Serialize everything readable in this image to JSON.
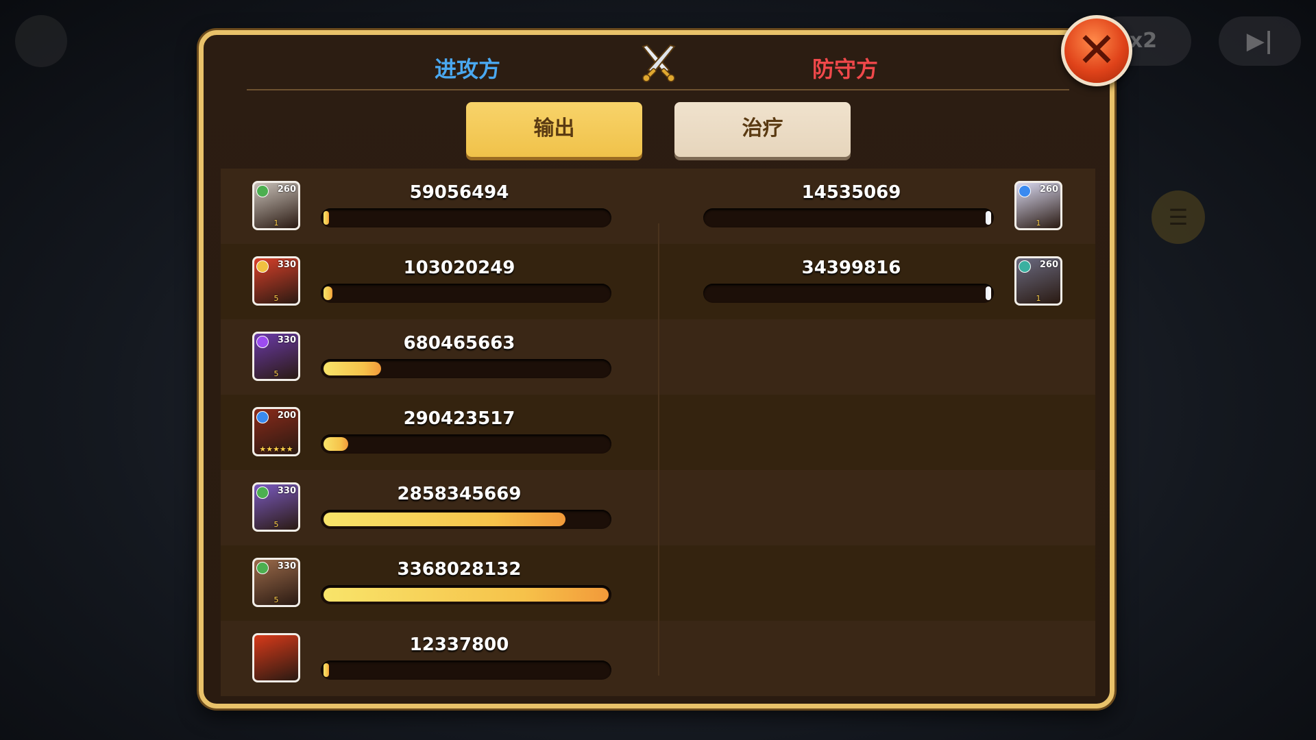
{
  "background": {
    "speed_label": "x2",
    "skip_label": "▶|",
    "list_icon": "☰"
  },
  "dialog": {
    "attacker_title": "进攻方",
    "defender_title": "防守方",
    "close_label": "✕",
    "tabs": [
      {
        "label": "输出",
        "selected": true
      },
      {
        "label": "治疗",
        "selected": false
      }
    ]
  },
  "attackers": [
    {
      "value": "59056494",
      "level": "260",
      "stars": "1",
      "faction_color": "#4caf50",
      "portrait_color": "#c8c0b8",
      "fraction": 0.018
    },
    {
      "value": "103020249",
      "level": "330",
      "stars": "5",
      "faction_color": "#f0c040",
      "portrait_color": "#d8402a",
      "fraction": 0.031
    },
    {
      "value": "680465663",
      "level": "330",
      "stars": "5",
      "faction_color": "#9c4cf0",
      "portrait_color": "#6a3aa8",
      "fraction": 0.202
    },
    {
      "value": "290423517",
      "level": "200",
      "stars": "★★★★★",
      "faction_color": "#3a8af0",
      "portrait_color": "#8a2a1a",
      "fraction": 0.086
    },
    {
      "value": "2858345669",
      "level": "330",
      "stars": "5",
      "faction_color": "#4caf50",
      "portrait_color": "#7a5ac0",
      "fraction": 0.849
    },
    {
      "value": "3368028132",
      "level": "330",
      "stars": "5",
      "faction_color": "#4caf50",
      "portrait_color": "#9a6a4a",
      "fraction": 1.0
    },
    {
      "value": "12337800",
      "level": "",
      "stars": "",
      "faction_color": "",
      "portrait_color": "#d83a1a",
      "fraction": 0.004
    }
  ],
  "defenders": [
    {
      "value": "14535069",
      "level": "260",
      "stars": "1",
      "faction_color": "#3a8af0",
      "portrait_color": "#d8d8f0",
      "fraction": 0.004
    },
    {
      "value": "34399816",
      "level": "260",
      "stars": "1",
      "faction_color": "#3ab0a0",
      "portrait_color": "#6a6a80",
      "fraction": 0.01
    }
  ]
}
